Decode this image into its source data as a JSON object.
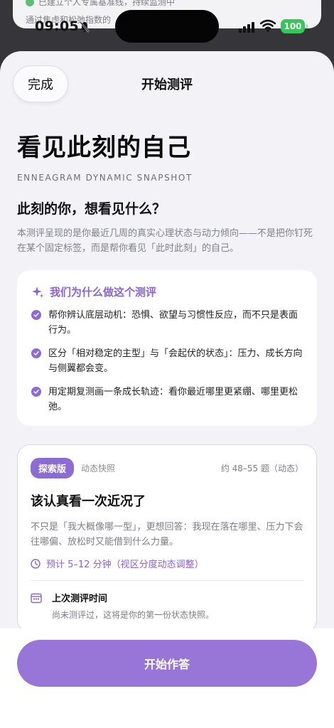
{
  "background": {
    "line1": "已建立个人专属基准线，持续监测中",
    "line2": "通过焦虑和松弛指数的"
  },
  "status_bar": {
    "time": "09:05",
    "battery": "100"
  },
  "nav": {
    "done_label": "完成",
    "title": "开始测评"
  },
  "hero": {
    "title": "看见此刻的自己",
    "subtitle_en": "ENNEAGRAM DYNAMIC SNAPSHOT",
    "question": "此刻的你，想看见什么？",
    "intro": "本测评呈现的是你最近几周的真实心理状态与动力倾向——不是把你钉死在某个固定标签，而是帮你看见「此时此刻」的自己。"
  },
  "why_card": {
    "title": "我们为什么做这个测评",
    "items": [
      "帮你辨认底层动机：恐惧、欲望与习惯性反应，而不只是表面行为。",
      "区分「相对稳定的主型」与「会起伏的状态」：压力、成长方向与侧翼都会变。",
      "用定期复测画一条成长轨迹：看你最近哪里更紧绷、哪里更松弛。"
    ]
  },
  "test_card": {
    "badge": "探索版",
    "tag": "动态快照",
    "count": "约 48–55 题（动态）",
    "title": "该认真看一次近况了",
    "desc": "不只是「我大概像哪一型」，更想回答：我现在落在哪里、压力下会往哪偏、放松时又能借到什么力量。",
    "duration": "预计 5–12 分钟（视区分度动态调整）",
    "last_title": "上次测评时间",
    "last_sub": "尚未测评过，这将是你的第一份状态快照。"
  },
  "cta": {
    "start_label": "开始作答"
  },
  "colors": {
    "accent": "#8c6bd3",
    "button": "#9876d8",
    "battery": "#34c759"
  }
}
